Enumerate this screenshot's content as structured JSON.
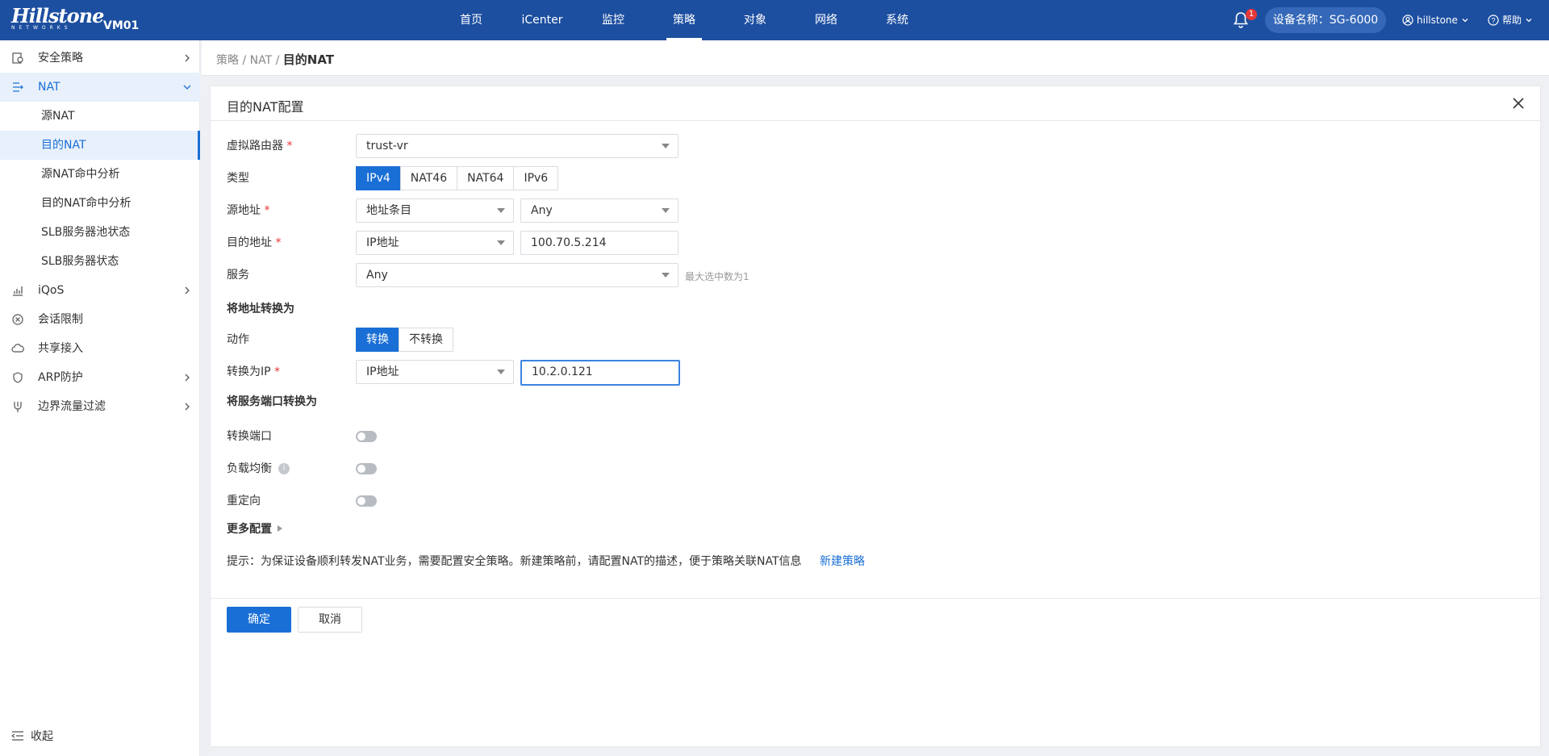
{
  "topbar": {
    "logo_text": "Hillstone",
    "logo_sub": "NETWORKS",
    "vm_name": "VM01",
    "nav": [
      "首页",
      "iCenter",
      "监控",
      "策略",
      "对象",
      "网络",
      "系统"
    ],
    "active_nav": "策略",
    "notification_count": "1",
    "device_name": "设备名称：SG-6000",
    "user": "hillstone",
    "help": "帮助"
  },
  "sidebar": {
    "items": [
      {
        "label": "安全策略",
        "icon": "shield-policy-icon"
      },
      {
        "label": "NAT",
        "icon": "nat-icon"
      },
      {
        "label": "iQoS",
        "icon": "bar-chart-icon"
      },
      {
        "label": "会话限制",
        "icon": "circle-x-icon"
      },
      {
        "label": "共享接入",
        "icon": "cloud-share-icon"
      },
      {
        "label": "ARP防护",
        "icon": "arp-icon"
      },
      {
        "label": "边界流量过滤",
        "icon": "filter-icon"
      }
    ],
    "nat_sub": [
      "源NAT",
      "目的NAT",
      "源NAT命中分析",
      "目的NAT命中分析",
      "SLB服务器池状态",
      "SLB服务器状态"
    ],
    "collapse": "收起"
  },
  "breadcrumb": {
    "part1": "策略",
    "sep": "/",
    "part2": "NAT",
    "current": "目的NAT"
  },
  "form": {
    "title": "目的NAT配置",
    "virtual_router": {
      "label": "虚拟路由器",
      "value": "trust-vr"
    },
    "type": {
      "label": "类型",
      "options": [
        "IPv4",
        "NAT46",
        "NAT64",
        "IPv6"
      ],
      "selected": "IPv4"
    },
    "src_addr": {
      "label": "源地址",
      "type_value": "地址条目",
      "value": "Any"
    },
    "dst_addr": {
      "label": "目的地址",
      "type_value": "IP地址",
      "value": "100.70.5.214"
    },
    "service": {
      "label": "服务",
      "value": "Any",
      "hint": "最大选中数为1"
    },
    "translate_section": "将地址转换为",
    "action": {
      "label": "动作",
      "options": [
        "转换",
        "不转换"
      ],
      "selected": "转换"
    },
    "translate_ip": {
      "label": "转换为IP",
      "type_value": "IP地址",
      "value": "10.2.0.121"
    },
    "port_section": "将服务端口转换为",
    "port_translate": {
      "label": "转换端口",
      "on": false
    },
    "load_balance": {
      "label": "负载均衡",
      "on": false
    },
    "redirect": {
      "label": "重定向",
      "on": false
    },
    "more": "更多配置",
    "tip": "提示：为保证设备顺利转发NAT业务，需要配置安全策略。新建策略前，请配置NAT的描述，便于策略关联NAT信息",
    "tip_link": "新建策略",
    "ok": "确定",
    "cancel": "取消"
  }
}
